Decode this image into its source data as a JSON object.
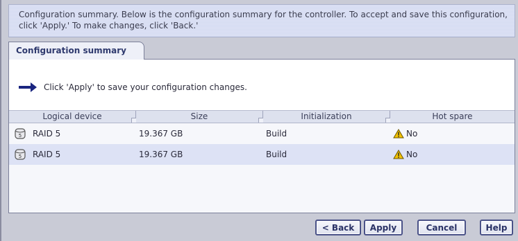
{
  "header": {
    "text": "Configuration summary. Below is the configuration summary for the controller.  To accept and save this configuration, click 'Apply.' To make changes, click 'Back.'"
  },
  "tabs": [
    {
      "label": "Configuration summary",
      "active": true
    }
  ],
  "instruction": {
    "icon": "right-arrow-icon",
    "text": "Click 'Apply' to save your configuration changes."
  },
  "table": {
    "columns": [
      "Logical device",
      "Size",
      "Initialization",
      "Hot spare"
    ],
    "rows": [
      {
        "device": "RAID 5",
        "size": "19.367 GB",
        "initialization": "Build",
        "hot_spare": "No"
      },
      {
        "device": "RAID 5",
        "size": "19.367 GB",
        "initialization": "Build",
        "hot_spare": "No"
      }
    ]
  },
  "buttons": {
    "back": "< Back",
    "apply": "Apply",
    "cancel": "Cancel",
    "help": "Help"
  },
  "colors": {
    "background": "#c9cbd6",
    "accent": "#2f3a6e",
    "row_alt": "#dde2f5",
    "warning": "#f2c200"
  }
}
